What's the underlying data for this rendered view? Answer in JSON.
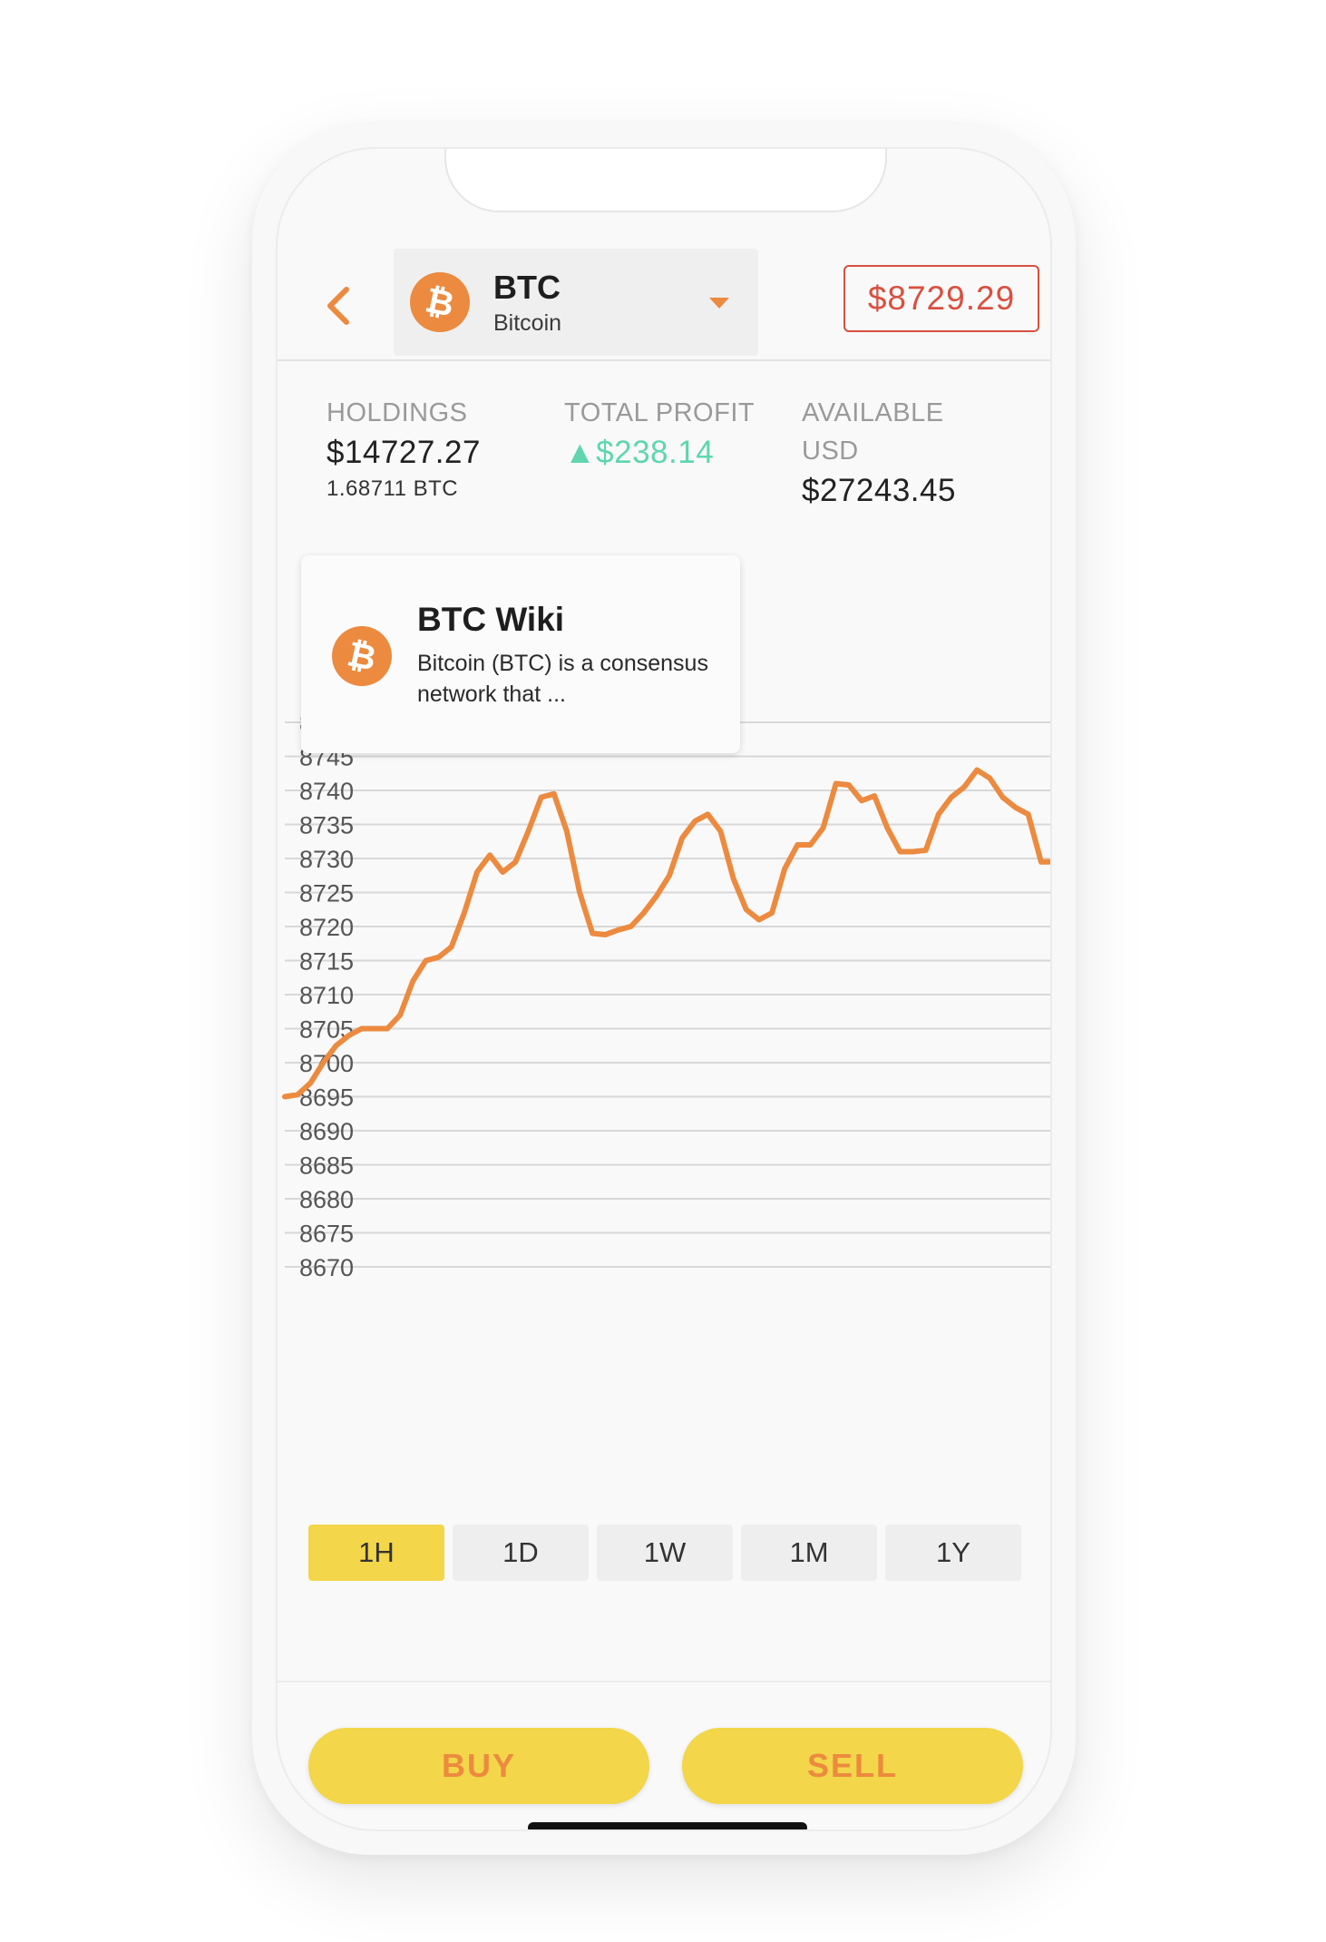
{
  "header": {
    "coin_symbol": "BTC",
    "coin_name": "Bitcoin",
    "price": "$8729.29"
  },
  "stats": {
    "holdings": {
      "label": "HOLDINGS",
      "value": "$14727.27",
      "sub": "1.68711 BTC"
    },
    "profit": {
      "label": "TOTAL PROFIT",
      "value": "▲$238.14"
    },
    "available": {
      "label_line1": "AVAILABLE",
      "label_line2": "USD",
      "value": "$27243.45"
    }
  },
  "wiki": {
    "title": "BTC Wiki",
    "description": "Bitcoin (BTC) is a consensus network that ..."
  },
  "colors": {
    "accent": "#ec8a3f",
    "price_red": "#d9503f",
    "profit_green": "#5fd6ad",
    "button_yellow": "#f3d649"
  },
  "icons": {
    "back": "chevron-left-icon",
    "coin": "bitcoin-icon",
    "dropdown": "caret-down-icon"
  },
  "chart_data": {
    "type": "line",
    "y_ticks": [
      "8750",
      "8745",
      "8740",
      "8735",
      "8730",
      "8725",
      "8720",
      "8715",
      "8710",
      "8705",
      "8700",
      "8695",
      "8690",
      "8685",
      "8680",
      "8675",
      "8670"
    ],
    "ylim": [
      8670,
      8750
    ],
    "grid": true,
    "series": [
      {
        "color": "#ec8a3f",
        "values": [
          8695,
          8695.3,
          8697,
          8700,
          8702.5,
          8704,
          8705,
          8705,
          8705,
          8707,
          8712,
          8715,
          8715.5,
          8717,
          8722,
          8728,
          8730.5,
          8728,
          8729.5,
          8734,
          8739,
          8739.5,
          8734,
          8725,
          8719,
          8718.8,
          8719.5,
          8720,
          8722,
          8724.5,
          8727.5,
          8733,
          8735.5,
          8736.5,
          8734,
          8727,
          8722.5,
          8721,
          8722,
          8728.5,
          8732,
          8732,
          8734.5,
          8741,
          8740.8,
          8738.5,
          8739.2,
          8734.5,
          8731,
          8731,
          8731.2,
          8736.5,
          8739,
          8740.5,
          8743,
          8741.8,
          8739,
          8737.5,
          8736.5,
          8729.5,
          8729.5
        ]
      }
    ]
  },
  "timeframes": {
    "options": [
      "1H",
      "1D",
      "1W",
      "1M",
      "1Y"
    ],
    "selected": "1H"
  },
  "actions": {
    "buy_label": "BUY",
    "sell_label": "SELL"
  }
}
